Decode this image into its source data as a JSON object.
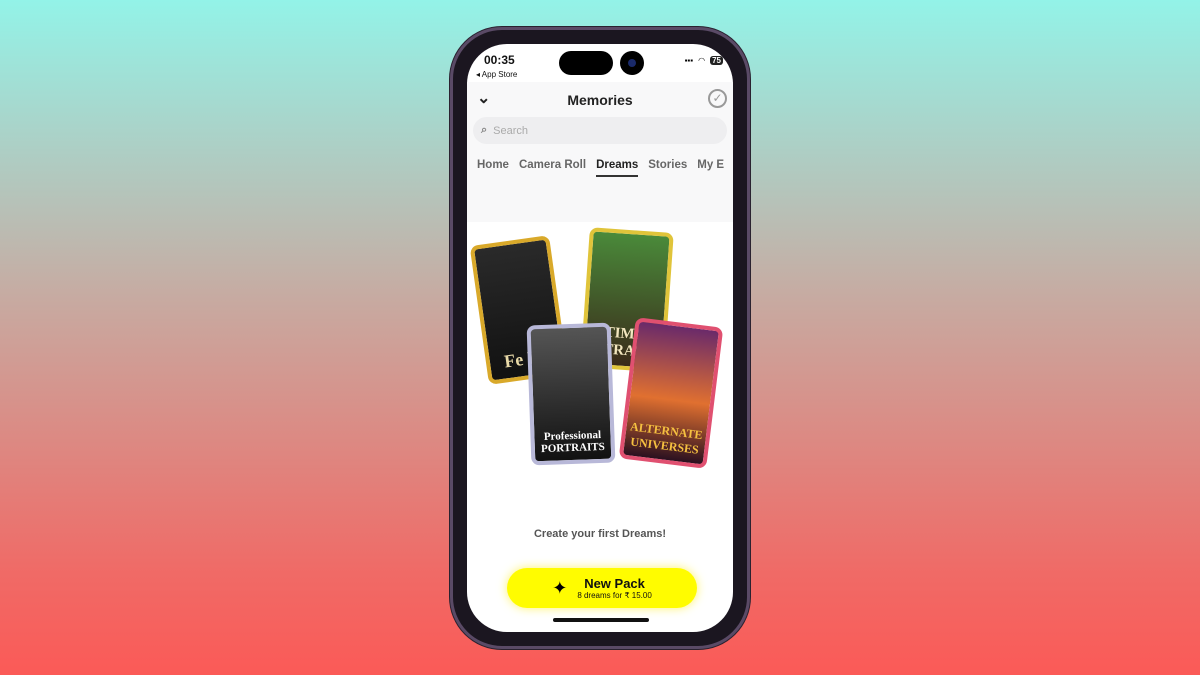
{
  "status": {
    "time": "00:35",
    "back_label": "◂ App Store",
    "battery": "75"
  },
  "header": {
    "title": "Memories"
  },
  "search": {
    "placeholder": "Search"
  },
  "tabs": [
    {
      "label": "Home"
    },
    {
      "label": "Camera Roll"
    },
    {
      "label": "Dreams",
      "active": true
    },
    {
      "label": "Stories"
    },
    {
      "label": "My E"
    }
  ],
  "cards": [
    {
      "text": "Fe Fa",
      "color": "#d9a92a"
    },
    {
      "text": "TIME TRAV",
      "color": "#e0c43a"
    },
    {
      "text": "Professional PORTRAITS",
      "color": "#b8b8d8"
    },
    {
      "text": "ALTERNATE UNIVERSES",
      "color": "#e05070"
    }
  ],
  "main": {
    "cta": "Create your first Dreams!",
    "button_title": "New Pack",
    "button_subtitle": "8 dreams for ₹ 15.00"
  },
  "colors": {
    "accent": "#fffc00"
  }
}
